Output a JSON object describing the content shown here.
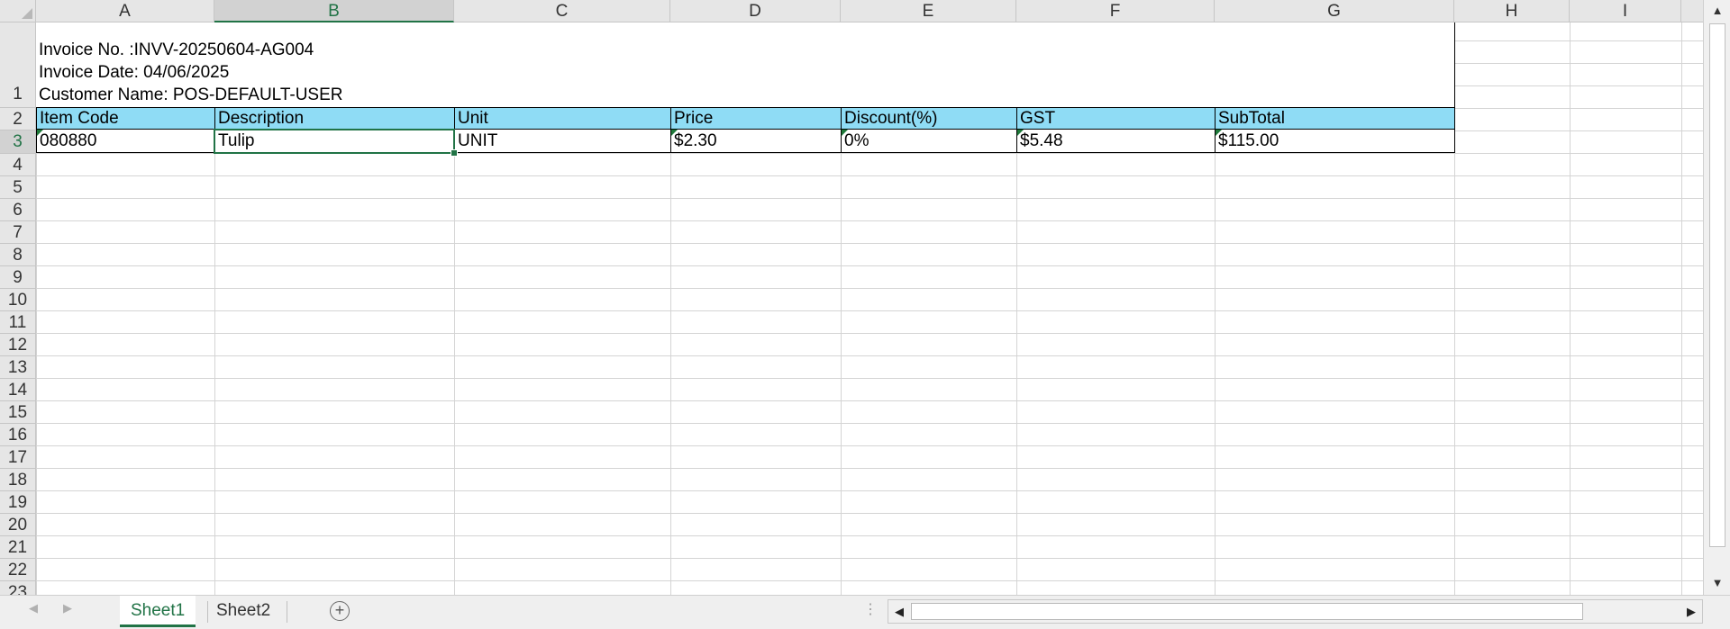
{
  "columns": [
    "A",
    "B",
    "C",
    "D",
    "E",
    "F",
    "G",
    "H",
    "I"
  ],
  "selected_column": "B",
  "rows": [
    "1",
    "2",
    "3",
    "4",
    "5",
    "6",
    "7",
    "8",
    "9",
    "10",
    "11",
    "12",
    "13",
    "14",
    "15",
    "16",
    "17",
    "18",
    "19",
    "20",
    "21",
    "22",
    "23"
  ],
  "selected_row": "3",
  "invoice": {
    "number_line": "Invoice No. :INVV-20250604-AG004",
    "date_line": "Invoice Date: 04/06/2025",
    "customer_line": "Customer Name: POS-DEFAULT-USER"
  },
  "table": {
    "headers": [
      "Item Code",
      "Description",
      "Unit",
      "Price",
      "Discount(%)",
      "GST",
      "SubTotal"
    ],
    "row": [
      "080880",
      "Tulip",
      "UNIT",
      "$2.30",
      "0%",
      "$5.48",
      "$115.00"
    ]
  },
  "sheets": [
    "Sheet1",
    "Sheet2"
  ],
  "active_sheet": "Sheet1",
  "add_sheet_symbol": "+",
  "colors": {
    "header_fill": "#8fdcf5",
    "accent": "#217346"
  },
  "icons": [
    "corner-select-all-icon",
    "scroll-up-icon",
    "scroll-down-icon",
    "sheet-nav-prev-icon",
    "sheet-nav-next-icon",
    "add-sheet-icon",
    "scroll-left-icon",
    "scroll-right-icon"
  ]
}
